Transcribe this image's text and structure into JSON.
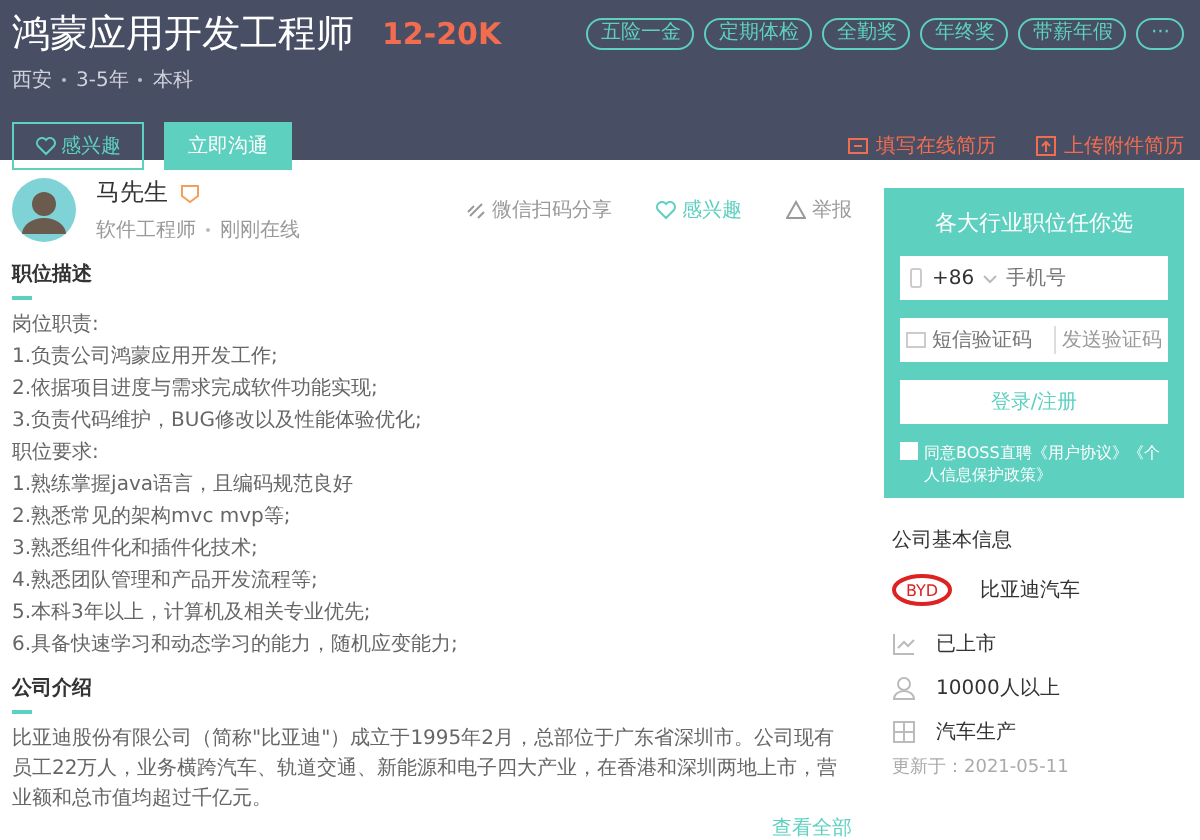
{
  "job": {
    "title": "鸿蒙应用开发工程师",
    "salary": "12-20K",
    "meta": [
      "西安",
      "3-5年",
      "本科"
    ],
    "tags": [
      "五险一金",
      "定期体检",
      "全勤奖",
      "年终奖",
      "带薪年假",
      "···"
    ],
    "interest_button": "感兴趣",
    "chat_button": "立即沟通",
    "resume_links": [
      {
        "kind": "form",
        "label": "填写在线简历"
      },
      {
        "kind": "upload",
        "label": "上传附件简历"
      }
    ]
  },
  "recruiter": {
    "name": "马先生",
    "role": "软件工程师",
    "status": "刚刚在线",
    "actions": [
      {
        "kind": "share",
        "label": "微信扫码分享"
      },
      {
        "kind": "like",
        "label": "感兴趣"
      },
      {
        "kind": "report",
        "label": "举报"
      }
    ]
  },
  "description": {
    "heading": "职位描述",
    "lines": [
      "岗位职责:",
      "1.负责公司鸿蒙应用开发工作;",
      "2.依据项目进度与需求完成软件功能实现;",
      "3.负责代码维护，BUG修改以及性能体验优化;",
      "职位要求:",
      "1.熟练掌握java语言，且编码规范良好",
      "2.熟悉常见的架构mvc mvp等;",
      "3.熟悉组件化和插件化技术;",
      "4.熟悉团队管理和产品开发流程等;",
      "5.本科3年以上，计算机及相关专业优先;",
      "6.具备快速学习和动态学习的能力，随机应变能力;"
    ]
  },
  "company_intro": {
    "heading": "公司介绍",
    "text": "比亚迪股份有限公司（简称\"比亚迪\"）成立于1995年2月，总部位于广东省深圳市。公司现有员工22万人，业务横跨汽车、轨道交通、新能源和电子四大产业，在香港和深圳两地上市，营业额和总市值均超过千亿元。",
    "more_link": "查看全部"
  },
  "login_card": {
    "title": "各大行业职位任你选",
    "country_code": "+86",
    "phone_placeholder": "手机号",
    "code_placeholder": "短信验证码",
    "send_code": "发送验证码",
    "submit": "登录/注册",
    "agreement": {
      "checked": false,
      "text": "同意BOSS直聘《用户协议》《个人信息保护政策》"
    }
  },
  "company_info": {
    "heading": "公司基本信息",
    "logo_text": "BYD",
    "name": "比亚迪汽车",
    "facts": [
      {
        "kind": "listed",
        "label": "已上市"
      },
      {
        "kind": "size",
        "label": "10000人以上"
      },
      {
        "kind": "industry",
        "label": "汽车生产"
      }
    ],
    "updated": "更新于：2021-05-11"
  }
}
